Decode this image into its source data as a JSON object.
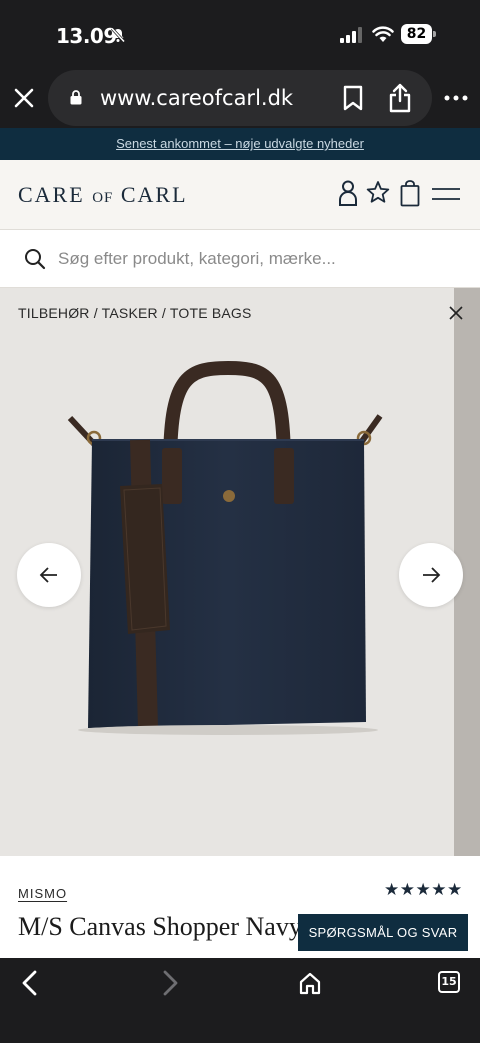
{
  "status": {
    "time": "13.09",
    "battery": "82"
  },
  "browser": {
    "url": "www.careofcarl.dk",
    "tab_count": "15"
  },
  "announcement": "Senest ankommet – nøje udvalgte nyheder",
  "header": {
    "logo_main_1": "CARE",
    "logo_of": "OF",
    "logo_main_2": "CARL"
  },
  "search": {
    "placeholder": "Søg efter produkt, kategori, mærke..."
  },
  "breadcrumb": {
    "items": [
      "TILBEHØR",
      "TASKER",
      "TOTE BAGS"
    ],
    "separator": " / "
  },
  "product": {
    "brand": "MISMO",
    "title": "M/S Canvas Shopper Navy",
    "rating_stars": "★★★★★",
    "faq_label": "SPØRGSMÅL OG SVAR"
  },
  "colors": {
    "navy": "#0f2d40",
    "logo": "#1b2a3a",
    "bag_canvas": "#1f2a3a",
    "leather": "#3a2a22"
  },
  "icons": [
    "bell-mute-icon",
    "signal-icon",
    "wifi-icon",
    "close-icon",
    "lock-icon",
    "bookmark-icon",
    "share-icon",
    "more-icon",
    "user-icon",
    "star-icon",
    "cart-icon",
    "menu-icon",
    "search-icon",
    "chevron-left-icon",
    "chevron-right-icon",
    "home-icon",
    "tabs-icon"
  ]
}
